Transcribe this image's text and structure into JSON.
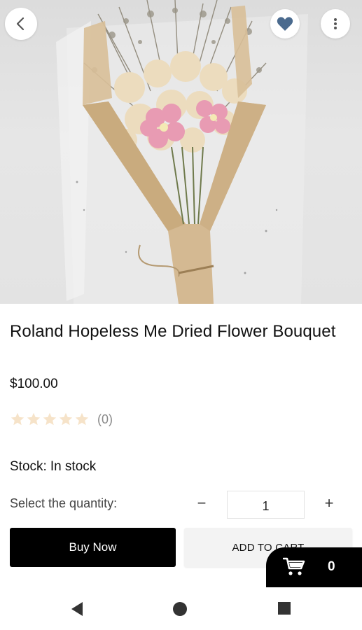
{
  "header": {
    "back_icon": "chevron-left-icon",
    "favorite_icon": "heart-icon",
    "more_icon": "more-vertical-icon"
  },
  "product": {
    "title": "Roland Hopeless Me Dried Flower Bouquet",
    "price": "$100.00",
    "rating": {
      "stars_filled": 0,
      "stars_total": 5,
      "review_count": "(0)",
      "star_color": "#f6e3c9"
    },
    "stock_label": "Stock:",
    "stock_value": "In stock"
  },
  "quantity": {
    "label": "Select the quantity:",
    "minus": "−",
    "plus": "+",
    "value": "1"
  },
  "actions": {
    "buy_now": "Buy Now",
    "add_to_cart": "ADD TO CART"
  },
  "cart": {
    "icon": "cart-icon",
    "count": "0"
  },
  "colors": {
    "primary": "#000000",
    "secondary_button": "#f3f3f3",
    "heart": "#4a6a8e",
    "muted_text": "#8a8a8a"
  }
}
